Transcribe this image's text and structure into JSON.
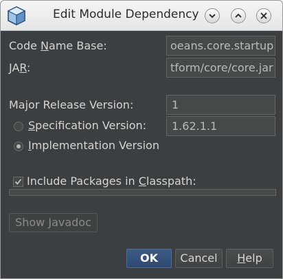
{
  "window": {
    "title": "Edit Module Dependency",
    "icon": "netbeans-cube-icon",
    "controls": [
      "minimize-icon",
      "maximize-icon",
      "close-icon"
    ]
  },
  "form": {
    "code_name_base": {
      "label_pre": "Code ",
      "label_mnemonic": "N",
      "label_post": "ame Base:",
      "value": "oeans.core.startup"
    },
    "jar": {
      "label_pre": "JA",
      "label_mnemonic": "R",
      "label_post": ":",
      "value": "tform/core/core.jar"
    },
    "major_release_version": {
      "label": "Major Release Version:",
      "value": "1"
    },
    "specification_version": {
      "label_mnemonic": "S",
      "label_post": "pecification Version:",
      "value": "1.62.1.1",
      "selected": false
    },
    "implementation_version": {
      "label_mnemonic": "I",
      "label_post": "mplementation Version",
      "selected": true
    },
    "include_packages": {
      "label_pre": "Include Packages in ",
      "label_mnemonic": "C",
      "label_post": "lasspath:",
      "checked": true
    }
  },
  "buttons": {
    "show_javadoc": "Show Javadoc",
    "ok": "OK",
    "cancel": "Cancel",
    "help_mnemonic": "H",
    "help_post": "elp"
  },
  "colors": {
    "background": "#3c3f41",
    "field": "#45494a",
    "text": "#d4d4d4",
    "default_button": "#2f4a70"
  }
}
